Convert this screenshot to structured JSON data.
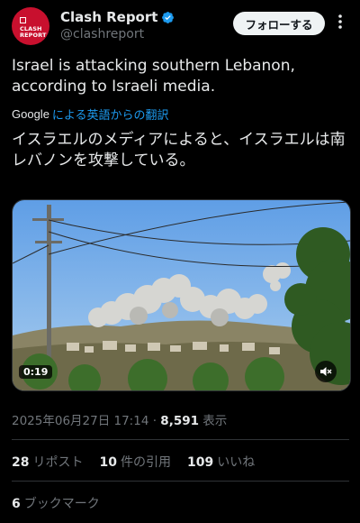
{
  "author": {
    "display_name": "Clash Report",
    "handle": "@clashreport",
    "avatar_text_line1": "CLASH",
    "avatar_text_line2": "REPORT",
    "verified": true
  },
  "follow_button": "フォローする",
  "tweet": {
    "text": "Israel is attacking southern Lebanon, according to Israeli media.",
    "translate_brand": "Google",
    "translate_label": "による英語からの翻訳",
    "translated_text": "イスラエルのメディアによると、イスラエルは南レバノンを攻撃している。"
  },
  "video": {
    "duration": "0:19"
  },
  "meta": {
    "timestamp": "2025年06月27日 17:14 · ",
    "views_count": "8,591",
    "views_label": " 表示"
  },
  "stats": {
    "reposts_count": "28",
    "reposts_label": "リポスト",
    "quotes_count": "10",
    "quotes_label": "件の引用",
    "likes_count": "109",
    "likes_label": "いいね",
    "bookmarks_count": "6",
    "bookmarks_label": "ブックマーク"
  },
  "colors": {
    "background": "#000000",
    "accent": "#1d9bf0",
    "verified": "#1d9bf0",
    "avatar": "#c8102e"
  }
}
